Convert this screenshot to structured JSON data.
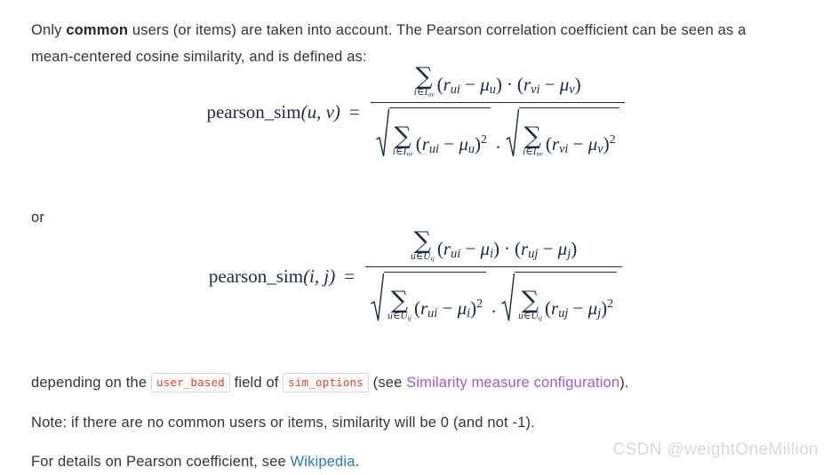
{
  "document": {
    "intro": {
      "before_strong": "Only ",
      "strong": "common",
      "after_strong": " users (or items) are taken into account. The Pearson correlation coefficient can be seen as a mean-centered cosine similarity, and is defined as:"
    },
    "or_label": "or",
    "depending": {
      "prefix": "depending on the",
      "code1": "user_based",
      "middle": "field of",
      "code2": "sim_options",
      "see_open": "(see",
      "link_text": "Similarity measure configuration",
      "suffix": ")."
    },
    "note": "Note: if there are no common users or items, similarity will be 0 (and not -1).",
    "details": {
      "prefix": "For details on Pearson coefficient, see ",
      "link_text": "Wikipedia",
      "suffix": "."
    },
    "watermark": "CSDN @weightOneMillion"
  },
  "formulas": [
    {
      "id": "pearson-user",
      "lhs_name": "pearson_sim",
      "lhs_args": "(u, v)",
      "lhs_arg1": "u",
      "lhs_arg2": "v",
      "equals": "=",
      "numerator": {
        "sum_symbol": "∑",
        "sum_limit_var": "i",
        "sum_limit_rel": "∈",
        "sum_limit_set": "I",
        "sum_limit_set_sub": "uv",
        "factor1": {
          "r": "r",
          "r_sub": "ui",
          "minus": "−",
          "mu": "μ",
          "mu_sub": "u"
        },
        "operator": "·",
        "factor2": {
          "r": "r",
          "r_sub": "vi",
          "minus": "−",
          "mu": "μ",
          "mu_sub": "v"
        }
      },
      "denominator": {
        "radical1": {
          "sum_symbol": "∑",
          "sum_limit_var": "i",
          "sum_limit_rel": "∈",
          "sum_limit_set": "I",
          "sum_limit_set_sub": "uv",
          "r": "r",
          "r_sub": "ui",
          "minus": "−",
          "mu": "μ",
          "mu_sub": "u",
          "power": "2"
        },
        "operator": "·",
        "radical2": {
          "sum_symbol": "∑",
          "sum_limit_var": "i",
          "sum_limit_rel": "∈",
          "sum_limit_set": "I",
          "sum_limit_set_sub": "uv",
          "r": "r",
          "r_sub": "vi",
          "minus": "−",
          "mu": "μ",
          "mu_sub": "v",
          "power": "2"
        }
      }
    },
    {
      "id": "pearson-item",
      "lhs_name": "pearson_sim",
      "lhs_args": "(i, j)",
      "lhs_arg1": "i",
      "lhs_arg2": "j",
      "equals": "=",
      "numerator": {
        "sum_symbol": "∑",
        "sum_limit_var": "u",
        "sum_limit_rel": "∈",
        "sum_limit_set": "U",
        "sum_limit_set_sub": "ij",
        "factor1": {
          "r": "r",
          "r_sub": "ui",
          "minus": "−",
          "mu": "μ",
          "mu_sub": "i"
        },
        "operator": "·",
        "factor2": {
          "r": "r",
          "r_sub": "uj",
          "minus": "−",
          "mu": "μ",
          "mu_sub": "j"
        }
      },
      "denominator": {
        "radical1": {
          "sum_symbol": "∑",
          "sum_limit_var": "u",
          "sum_limit_rel": "∈",
          "sum_limit_set": "U",
          "sum_limit_set_sub": "ij",
          "r": "r",
          "r_sub": "ui",
          "minus": "−",
          "mu": "μ",
          "mu_sub": "i",
          "power": "2"
        },
        "operator": "·",
        "radical2": {
          "sum_symbol": "∑",
          "sum_limit_var": "u",
          "sum_limit_rel": "∈",
          "sum_limit_set": "U",
          "sum_limit_set_sub": "ij",
          "r": "r",
          "r_sub": "uj",
          "minus": "−",
          "mu": "μ",
          "mu_sub": "j",
          "power": "2"
        }
      }
    }
  ],
  "colors": {
    "body_text": "#33343a",
    "math_text": "#1b2a45",
    "code_text": "#e8402a",
    "code_border": "#d6d6d6",
    "link_violet": "#a259c4",
    "link_blue": "#2a7ab9",
    "watermark": "#d8d8d8",
    "background": "#ffffff"
  }
}
